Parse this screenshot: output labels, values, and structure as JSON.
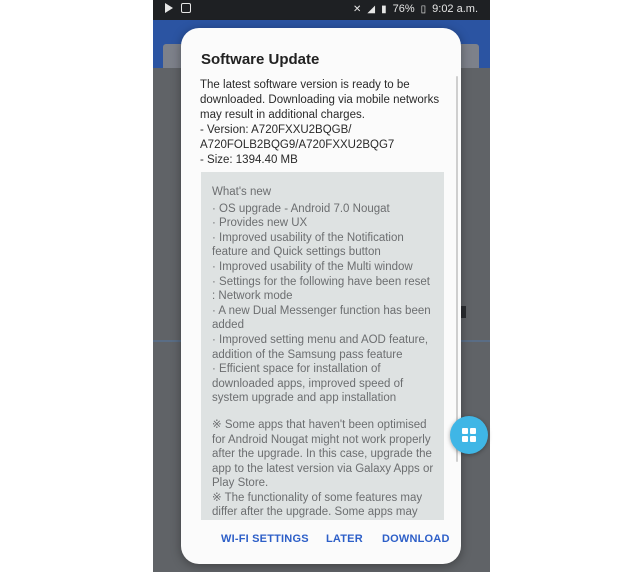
{
  "statusbar": {
    "battery": "76%",
    "time": "9:02 a.m."
  },
  "dialog": {
    "title": "Software Update",
    "intro": "The latest software version is ready to be downloaded. Downloading via mobile networks may result in additional charges.",
    "version_line1": "- Version: A720FXXU2BQGB/",
    "version_line2": "A720FOLB2BQG9/A720FXXU2BQG7",
    "size": "- Size: 1394.40 MB",
    "whats_new": {
      "heading": "What's new",
      "items": [
        "· OS upgrade - Android 7.0 Nougat",
        "· Provides new UX",
        "· Improved usability of the Notification feature and Quick settings button",
        "· Improved usability of the Multi window",
        "· Settings for the following have been reset : Network mode",
        "· A new Dual Messenger function has been added",
        "· Improved setting menu and AOD feature, addition of the Samsung pass feature",
        "· Efficient space for installation of downloaded apps, improved speed of system upgrade and app installation"
      ],
      "note1": "※ Some apps that haven't been optimised for Android Nougat might not work properly after the upgrade. In this case, upgrade the app to the latest version via Galaxy Apps or Play Store.",
      "note2": "※ The functionality of some features may differ after the upgrade. Some apps may"
    },
    "buttons": {
      "wifi_settings": "WI-FI SETTINGS",
      "later": "LATER",
      "download": "DOWNLOAD"
    }
  },
  "colors": {
    "accent": "#2d5fc8",
    "fab": "#3fb6e6",
    "app_bar": "#2b54a2"
  },
  "icons": [
    "play-icon",
    "notification-icon",
    "mute-icon",
    "wifi-icon",
    "signal-icon",
    "battery-icon",
    "apps-grid-icon"
  ]
}
